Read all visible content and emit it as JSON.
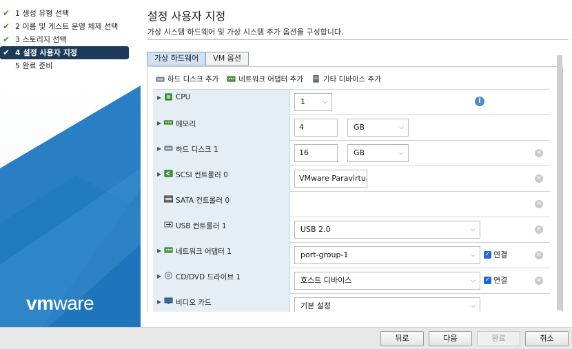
{
  "wizard": {
    "steps": [
      {
        "label": "1 생성 유형 선택",
        "done": true
      },
      {
        "label": "2 이름 및 게스트 운영 체제 선택",
        "done": true
      },
      {
        "label": "3 스토리지 선택",
        "done": true
      },
      {
        "label": "4 설정 사용자 지정",
        "done": true,
        "active": true
      },
      {
        "label": "5 완료 준비",
        "done": false
      }
    ],
    "logo": {
      "vm": "vm",
      "ware": "ware"
    }
  },
  "page": {
    "title": "설정 사용자 지정",
    "subtitle": "가상 시스템 하드웨어 및 가상 시스템 추가 옵션을 구성합니다."
  },
  "tabs": [
    {
      "label": "가상 하드웨어",
      "active": true
    },
    {
      "label": "VM 옵션",
      "active": false
    }
  ],
  "add_bar": {
    "add_disk": "하드 디스크 추가",
    "add_nic": "네트워크 어댑터 추가",
    "add_other": "기타 디바이스 추가"
  },
  "hardware": {
    "cpu": {
      "label": "CPU",
      "value": "1"
    },
    "memory": {
      "label": "메모리",
      "value": "4",
      "unit": "GB"
    },
    "disk1": {
      "label": "하드 디스크 1",
      "value": "16",
      "unit": "GB"
    },
    "scsi": {
      "label": "SCSI 컨트롤러 0",
      "value": "VMware Paravirtual"
    },
    "sata": {
      "label": "SATA 컨트롤러 0"
    },
    "usb": {
      "label": "USB 컨트롤러 1",
      "value": "USB 2.0"
    },
    "nic1": {
      "label": "네트워크 어댑터 1",
      "value": "port-group-1",
      "connect_label": "연결",
      "connected": true
    },
    "dvd1": {
      "label": "CD/DVD 드라이브 1",
      "value": "호스트 디바이스",
      "connect_label": "연결",
      "connected": true
    },
    "video": {
      "label": "비디오 카드",
      "value": "기본 설정"
    }
  },
  "footer": {
    "back": "뒤로",
    "next": "다음",
    "finish": "완료",
    "cancel": "취소"
  },
  "colors": {
    "active_step_bg": "#1d3a5a",
    "brand_blue": "#1c6fb4",
    "row_label_bg": "#e6eef5",
    "check": "#3c9a28"
  }
}
